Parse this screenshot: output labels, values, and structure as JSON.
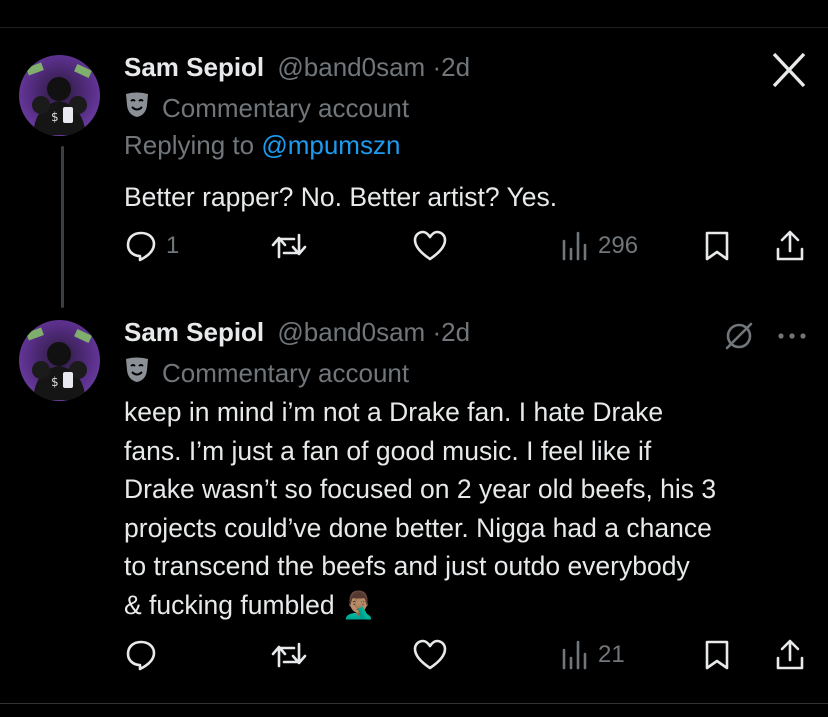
{
  "close_label": "Close",
  "tweets": [
    {
      "name": "Sam Sepiol",
      "handle": "@band0sam",
      "dot": "·",
      "time": "2d",
      "badge": "Commentary account",
      "replying_prefix": "Replying to ",
      "replying_to": "@mpumszn",
      "text": "Better rapper? No. Better artist? Yes.",
      "replies": "1",
      "views": "296"
    },
    {
      "name": "Sam Sepiol",
      "handle": "@band0sam",
      "dot": "·",
      "time": "2d",
      "badge": "Commentary account",
      "text_lines": [
        "keep in mind i’m not a Drake fan. I hate Drake",
        "fans. I’m just a fan of good music. I feel like if",
        "Drake wasn’t so focused on 2 year old beefs, his 3",
        "projects could’ve done better. Nigga had a chance",
        "to transcend the beefs and just outdo everybody",
        "& fucking fumbled 🤦🏽‍♂️"
      ],
      "views": "21"
    }
  ],
  "icons": {
    "close": "x-close-icon",
    "badge": "theater-mask-icon",
    "reply": "reply-icon",
    "retweet": "retweet-icon",
    "like": "heart-icon",
    "views": "views-icon",
    "bookmark": "bookmark-icon",
    "share": "share-icon",
    "mute": "mute-icon",
    "more": "more-icon"
  },
  "colors": {
    "background": "#000000",
    "text": "#e7e9ea",
    "muted": "#71767b",
    "link": "#1d9bf0"
  }
}
